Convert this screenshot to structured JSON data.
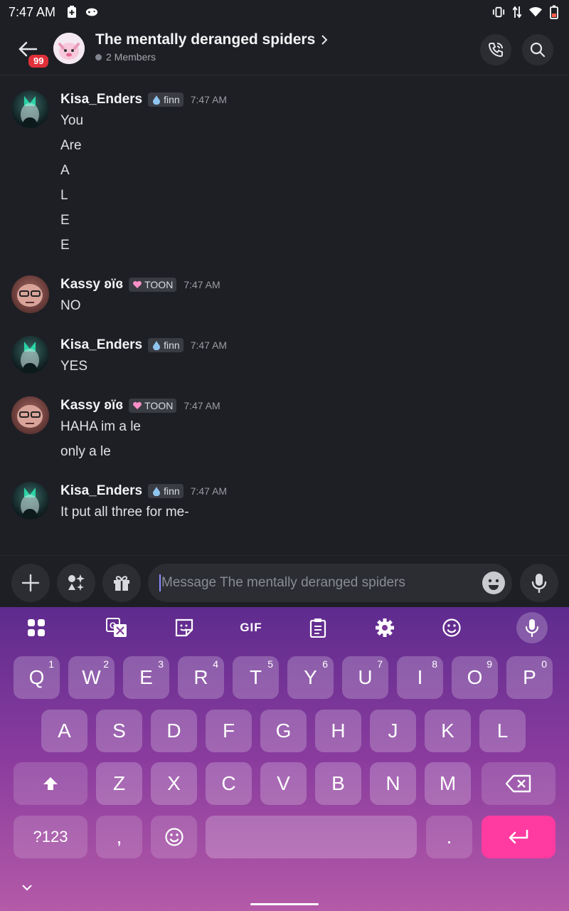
{
  "status_bar": {
    "time": "7:47 AM"
  },
  "header": {
    "unread_badge": "99",
    "channel_title": "The mentally deranged spiders",
    "members": "2 Members"
  },
  "messages": [
    {
      "author": "Kisa_Enders",
      "tag": "finn",
      "time": "7:47 AM",
      "lines": [
        "You",
        "Are",
        "A",
        "L",
        "E",
        "E"
      ]
    },
    {
      "author": "Kassy ʚïɞ",
      "tag": "TOON",
      "time": "7:47 AM",
      "lines": [
        "NO"
      ]
    },
    {
      "author": "Kisa_Enders",
      "tag": "finn",
      "time": "7:47 AM",
      "lines": [
        "YES"
      ]
    },
    {
      "author": "Kassy ʚïɞ",
      "tag": "TOON",
      "time": "7:47 AM",
      "lines": [
        "HAHA im a le",
        "only a le"
      ]
    },
    {
      "author": "Kisa_Enders",
      "tag": "finn",
      "time": "7:47 AM",
      "lines": [
        "It put all three for me-"
      ]
    }
  ],
  "composer": {
    "placeholder": "Message The mentally deranged spiders"
  },
  "keyboard": {
    "toolbar_gif": "GIF",
    "row1": [
      {
        "k": "Q",
        "h": "1"
      },
      {
        "k": "W",
        "h": "2"
      },
      {
        "k": "E",
        "h": "3"
      },
      {
        "k": "R",
        "h": "4"
      },
      {
        "k": "T",
        "h": "5"
      },
      {
        "k": "Y",
        "h": "6"
      },
      {
        "k": "U",
        "h": "7"
      },
      {
        "k": "I",
        "h": "8"
      },
      {
        "k": "O",
        "h": "9"
      },
      {
        "k": "P",
        "h": "0"
      }
    ],
    "row2": [
      "A",
      "S",
      "D",
      "F",
      "G",
      "H",
      "J",
      "K",
      "L"
    ],
    "row3": [
      "Z",
      "X",
      "C",
      "V",
      "B",
      "N",
      "M"
    ],
    "symbols": "?123",
    "comma": ",",
    "period": "."
  }
}
